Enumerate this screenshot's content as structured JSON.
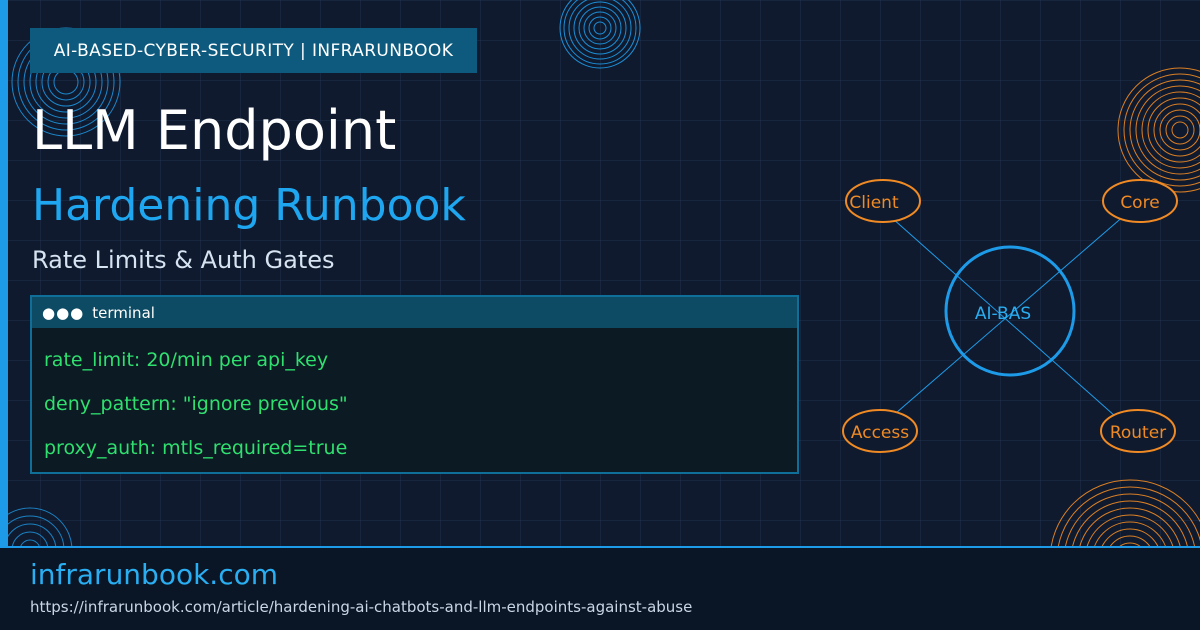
{
  "badge": "AI-BASED-CYBER-SECURITY | INFRARUNBOOK",
  "title": "LLM Endpoint",
  "subtitle": "Hardening Runbook",
  "tagline": "Rate Limits & Auth Gates",
  "terminal": {
    "dots": "●●●",
    "title": "terminal",
    "lines": [
      "rate_limit: 20/min per api_key",
      "deny_pattern: \"ignore previous\"",
      "proxy_auth: mtls_required=true"
    ]
  },
  "diagram": {
    "center": "AI-BAS",
    "nodes": [
      "Client",
      "Core",
      "Access",
      "Router"
    ]
  },
  "footer": {
    "site": "infrarunbook.com",
    "url": "https://infrarunbook.com/article/hardening-ai-chatbots-and-llm-endpoints-against-abuse"
  },
  "colors": {
    "accent": "#1e9be8",
    "orange": "#f08a24",
    "terminal_text": "#2fe06f",
    "background": "#0f1a2e"
  }
}
